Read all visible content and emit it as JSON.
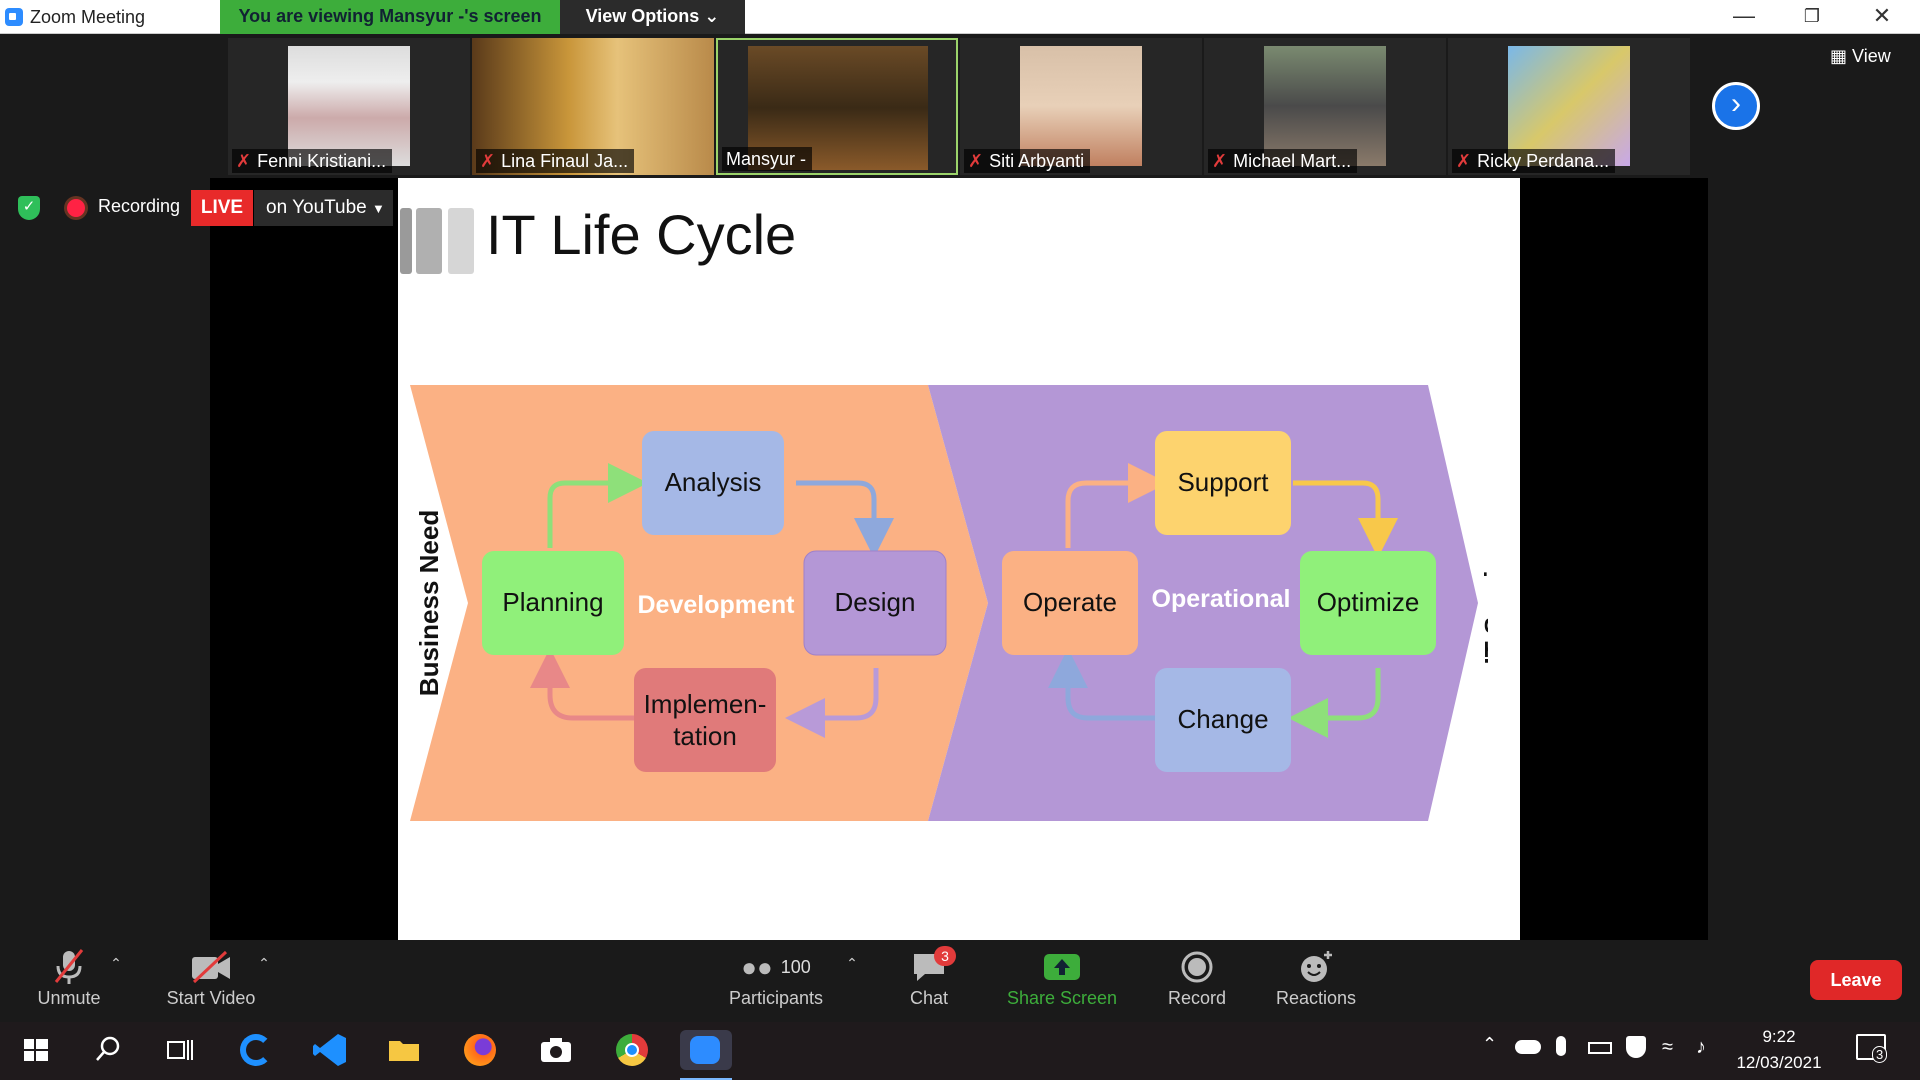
{
  "window": {
    "title": "Zoom Meeting",
    "viewing_banner": "You are viewing Mansyur -'s screen",
    "view_options": "View Options ⌄"
  },
  "participants_strip": [
    {
      "name": "Fenni Kristiani...",
      "muted": true,
      "active": false
    },
    {
      "name": "Lina Finaul Ja...",
      "muted": true,
      "active": false
    },
    {
      "name": "Mansyur -",
      "muted": false,
      "active": true
    },
    {
      "name": "Siti Arbyanti",
      "muted": true,
      "active": false
    },
    {
      "name": "Michael Mart...",
      "muted": true,
      "active": false
    },
    {
      "name": "Ricky Perdana...",
      "muted": true,
      "active": false
    }
  ],
  "view_button": "View",
  "recording": {
    "label": "Recording",
    "live": "LIVE",
    "destination": "on YouTube"
  },
  "slide": {
    "title": "IT Life Cycle",
    "left_label": "Business Need",
    "right_label": "IT Service",
    "dev_label": "Development",
    "ops_label": "Operational",
    "nodes": {
      "analysis": "Analysis",
      "planning": "Planning",
      "design": "Design",
      "implementation_1": "Implemen-",
      "implementation_2": "tation",
      "support": "Support",
      "operate": "Operate",
      "optimize": "Optimize",
      "change": "Change"
    }
  },
  "toolbar": {
    "unmute": "Unmute",
    "start_video": "Start Video",
    "participants": "Participants",
    "participants_count": "100",
    "chat": "Chat",
    "chat_badge": "3",
    "share_screen": "Share Screen",
    "record": "Record",
    "reactions": "Reactions",
    "leave": "Leave"
  },
  "taskbar": {
    "time": "9:22",
    "date": "12/03/2021",
    "notification_count": "3"
  },
  "colors": {
    "zoom_blue": "#2d8cff",
    "share_green": "#3dad3b",
    "leave_red": "#e02828",
    "dev_orange": "#fbb184",
    "ops_purple": "#b497d6"
  }
}
